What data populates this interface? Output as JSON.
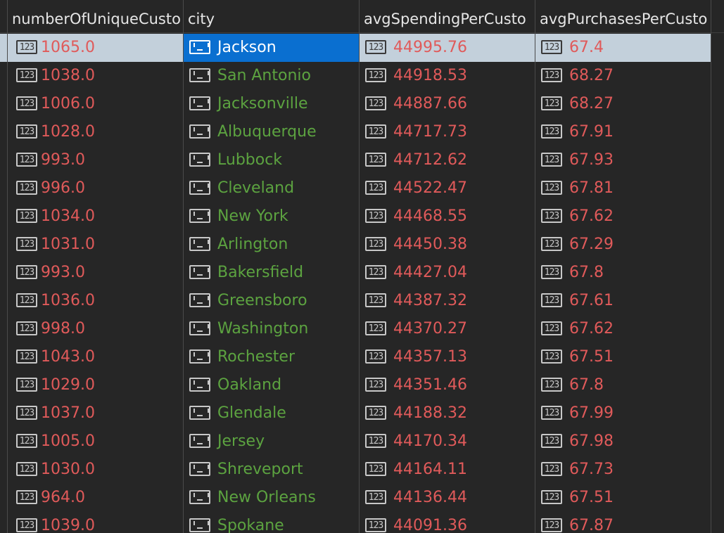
{
  "columns": [
    {
      "label": "numberOfUniqueCusto",
      "type": "number"
    },
    {
      "label": "city",
      "type": "string"
    },
    {
      "label": "avgSpendingPerCusto",
      "type": "number"
    },
    {
      "label": "avgPurchasesPerCusto",
      "type": "number"
    }
  ],
  "icons": {
    "number": "numeric-type-icon",
    "string": "string-type-icon"
  },
  "selected_row": 0,
  "selected_col": 1,
  "colors": {
    "background": "#262626",
    "header_text": "#e6e6e6",
    "number_text": "#e05a5a",
    "string_text": "#5ca340",
    "selected_row": "#c3d0db",
    "selected_cell": "#0a6fd0"
  },
  "rows": [
    [
      "1065.0",
      "Jackson",
      "44995.76",
      "67.4"
    ],
    [
      "1038.0",
      "San Antonio",
      "44918.53",
      "68.27"
    ],
    [
      "1006.0",
      "Jacksonville",
      "44887.66",
      "68.27"
    ],
    [
      "1028.0",
      "Albuquerque",
      "44717.73",
      "67.91"
    ],
    [
      "993.0",
      "Lubbock",
      "44712.62",
      "67.93"
    ],
    [
      "996.0",
      "Cleveland",
      "44522.47",
      "67.81"
    ],
    [
      "1034.0",
      "New York",
      "44468.55",
      "67.62"
    ],
    [
      "1031.0",
      "Arlington",
      "44450.38",
      "67.29"
    ],
    [
      "993.0",
      "Bakersfield",
      "44427.04",
      "67.8"
    ],
    [
      "1036.0",
      "Greensboro",
      "44387.32",
      "67.61"
    ],
    [
      "998.0",
      "Washington",
      "44370.27",
      "67.62"
    ],
    [
      "1043.0",
      "Rochester",
      "44357.13",
      "67.51"
    ],
    [
      "1029.0",
      "Oakland",
      "44351.46",
      "67.8"
    ],
    [
      "1037.0",
      "Glendale",
      "44188.32",
      "67.99"
    ],
    [
      "1005.0",
      "Jersey",
      "44170.34",
      "67.98"
    ],
    [
      "1030.0",
      "Shreveport",
      "44164.11",
      "67.73"
    ],
    [
      "964.0",
      "New Orleans",
      "44136.44",
      "67.51"
    ],
    [
      "1039.0",
      "Spokane",
      "44091.36",
      "67.87"
    ]
  ]
}
